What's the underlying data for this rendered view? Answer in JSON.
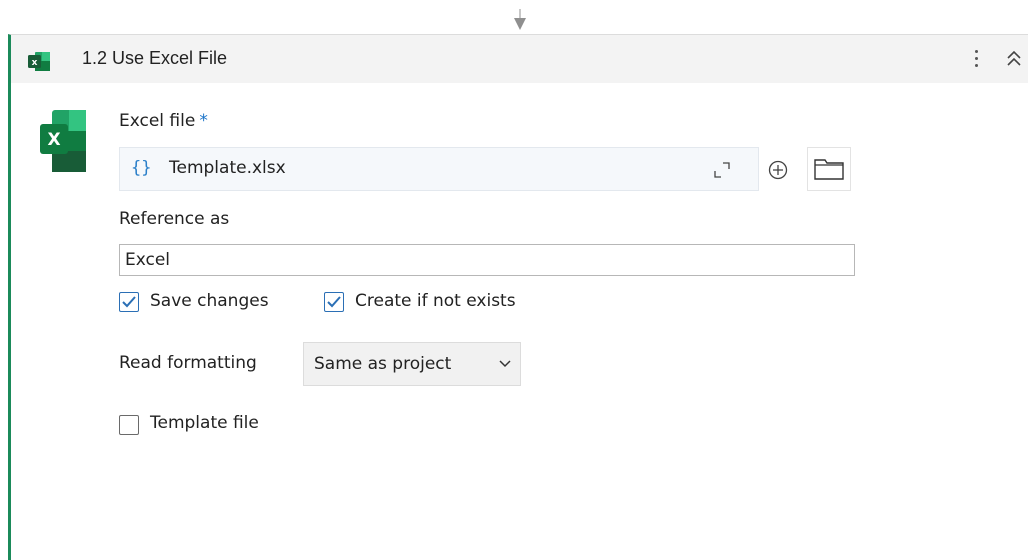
{
  "activity": {
    "number": "1.2",
    "title": "1.2 Use Excel File"
  },
  "fields": {
    "excel_file": {
      "label": "Excel file",
      "required_marker": "*",
      "brace": "{}",
      "value": "Template.xlsx"
    },
    "reference_as": {
      "label": "Reference as",
      "value": "Excel"
    },
    "save_changes": {
      "label": "Save changes",
      "checked": true
    },
    "create_if_not_exists": {
      "label": "Create if not exists",
      "checked": true
    },
    "read_formatting": {
      "label": "Read formatting",
      "selected": "Same as project"
    },
    "template_file": {
      "label": "Template file",
      "checked": false
    }
  },
  "icons": {
    "header": "excel-icon",
    "menu": "more-vertical-icon",
    "collapse": "double-chevron-up-icon",
    "expand": "expand-icon",
    "add": "plus-circle-icon",
    "browse": "folder-icon"
  },
  "colors": {
    "accent_border": "#1b8a5a",
    "excel_green": "#1d7a45",
    "checkbox_blue": "#2b6fb5",
    "brace_blue": "#2a7fc9"
  }
}
